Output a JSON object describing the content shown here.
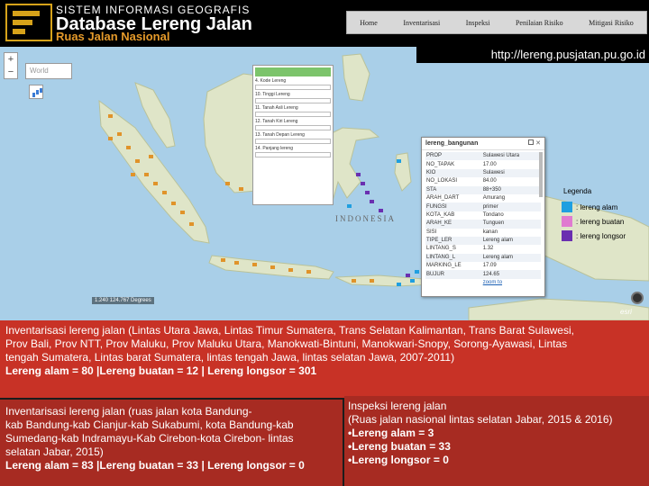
{
  "header": {
    "app_subtitle": "SISTEM INFORMASI GEOGRAFIS",
    "app_title": "Database Lereng Jalan",
    "app_section": "Ruas Jalan Nasional",
    "nav": [
      "Home",
      "Inventarisasi",
      "Inspeksi",
      "Penilaian Risiko",
      "Mitigasi Risiko"
    ],
    "url": "http://lereng.pusjatan.pu.go.id"
  },
  "map": {
    "search_placeholder": "World",
    "zoom_in": "+",
    "zoom_out": "−",
    "country_label": "INDONESIA",
    "scale_text": "1.240 124.767 Degrees",
    "esri": "esri"
  },
  "form_panel": {
    "header": "",
    "rows": [
      "4. Kode Lereng",
      "10. Tinggi Lereng",
      "11. Tanah Asli Lereng",
      "12. Tanah Kiri Lereng",
      "13. Tanah Depan Lereng",
      "14. Panjang lereng"
    ]
  },
  "attr_panel": {
    "title": "lereng_bangunan",
    "rows": [
      [
        "PROP",
        "Sulawesi Utara"
      ],
      [
        "NO_TAPAK",
        "17.00"
      ],
      [
        "KIO",
        "Sulawesi"
      ],
      [
        "NO_LOKASI",
        "84.00"
      ],
      [
        "STA",
        "88+350"
      ],
      [
        "ARAH_DART",
        "Amurang"
      ],
      [
        "FUNGSI",
        "primer"
      ],
      [
        "KOTA_KAB",
        "Tondano"
      ],
      [
        "ARAH_KE",
        "Tunguen"
      ],
      [
        "SISI",
        "kanan"
      ],
      [
        "TIPE_LER",
        "Lereng alam"
      ],
      [
        "LINTANG_S",
        "1.32"
      ],
      [
        "LINTANG_L",
        "Lereng alam"
      ],
      [
        "MARKING_LE",
        "17.09"
      ],
      [
        "BUJUR",
        "124.65"
      ],
      [
        "",
        "zoom to"
      ]
    ]
  },
  "legend": {
    "title": "Legenda",
    "items": [
      {
        "label": ": lereng alam",
        "color": "#1f9fe0"
      },
      {
        "label": ": lereng buatan",
        "color": "#e07bd0"
      },
      {
        "label": ": lereng longsor",
        "color": "#6a2fb0"
      }
    ]
  },
  "text_blocks": {
    "block1_line1": "Inventarisasi lereng jalan (Lintas Utara Jawa, Lintas Timur Sumatera, Trans Selatan Kalimantan, Trans Barat Sulawesi,",
    "block1_line2": "Prov Bali, Prov NTT, Prov Maluku, Prov Maluku Utara, Manokwati-Bintuni, Manokwari-Snopy, Sorong-Ayawasi, Lintas",
    "block1_line3": "tengah Sumatera, Lintas barat Sumatera, lintas tengah Jawa, lintas selatan Jawa, 2007-2011)",
    "block1_line4": "Lereng alam = 80 |Lereng buatan = 12 | Lereng longsor = 301",
    "block2_line1": "Inventarisasi lereng jalan (ruas jalan kota Bandung-",
    "block2_line2": "kab Bandung-kab Cianjur-kab Sukabumi, kota Bandung-kab",
    "block2_line3": "Sumedang-kab Indramayu-Kab Cirebon-kota Cirebon- lintas",
    "block2_line4": "selatan Jabar, 2015)",
    "block2_line5": "Lereng alam = 83  |Lereng buatan = 33  | Lereng longsor = 0",
    "block3_line1": "Inspeksi lereng jalan",
    "block3_line2": "(Ruas jalan nasional lintas selatan Jabar, 2015 & 2016)",
    "block3_line3": "•Lereng alam = 3",
    "block3_line4": "•Lereng buatan =  33",
    "block3_line5": "•Lereng longsor = 0"
  }
}
